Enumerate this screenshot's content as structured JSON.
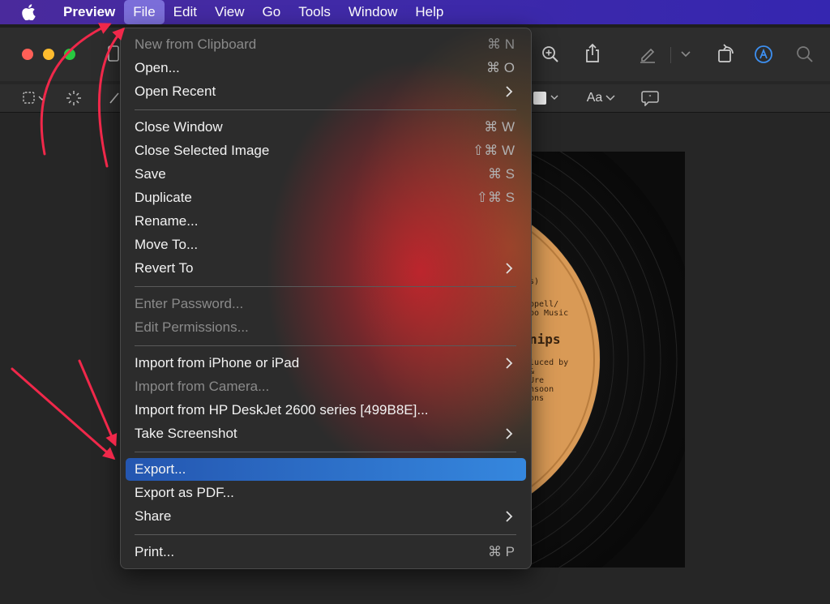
{
  "menubar": {
    "apple_icon": "apple-icon",
    "items": [
      "Preview",
      "File",
      "Edit",
      "View",
      "Go",
      "Tools",
      "Window",
      "Help"
    ],
    "active": "File",
    "colors": {
      "bar": "#3f2aa8",
      "active": "#7b6ed9"
    }
  },
  "toolbar": {
    "icons": [
      "sidebar-icon",
      "zoom-in-icon",
      "share-icon",
      "markup-pen-icon",
      "chevron-down-icon",
      "rotate-icon",
      "markup-icon",
      "search-icon"
    ],
    "markup_icons": [
      "rect-select-icon",
      "instant-alpha-icon",
      "sketch-icon",
      "fill-color-icon",
      "font-icon",
      "speech-bubble-icon"
    ],
    "font_label": "Aa"
  },
  "document": {
    "label_lines": [
      "s)",
      "ppell/",
      "bo Music",
      "nips",
      "luced by",
      "&",
      "Ure",
      "nsoon",
      "ons"
    ]
  },
  "file_menu": {
    "items": [
      {
        "label": "New from Clipboard",
        "shortcut": "⌘ N",
        "disabled": true
      },
      {
        "label": "Open...",
        "shortcut": "⌘ O"
      },
      {
        "label": "Open Recent",
        "submenu": true
      },
      {
        "label": "Close Window",
        "shortcut": "⌘ W"
      },
      {
        "label": "Close Selected Image",
        "shortcut": "⇧⌘ W"
      },
      {
        "label": "Save",
        "shortcut": "⌘ S"
      },
      {
        "label": "Duplicate",
        "shortcut": "⇧⌘ S"
      },
      {
        "label": "Rename..."
      },
      {
        "label": "Move To..."
      },
      {
        "label": "Revert To",
        "submenu": true
      },
      {
        "label": "Enter Password...",
        "disabled": true
      },
      {
        "label": "Edit Permissions...",
        "disabled": true
      },
      {
        "label": "Import from iPhone or iPad",
        "submenu": true
      },
      {
        "label": "Import from Camera...",
        "disabled": true
      },
      {
        "label": "Import from HP DeskJet 2600 series [499B8E]..."
      },
      {
        "label": "Take Screenshot",
        "submenu": true
      },
      {
        "label": "Export...",
        "selected": true
      },
      {
        "label": "Export as PDF..."
      },
      {
        "label": "Share",
        "submenu": true
      },
      {
        "label": "Print...",
        "shortcut": "⌘ P"
      }
    ],
    "selection_color": "#2f75cf"
  },
  "annotation": {
    "arrow_color": "#f0284a"
  }
}
